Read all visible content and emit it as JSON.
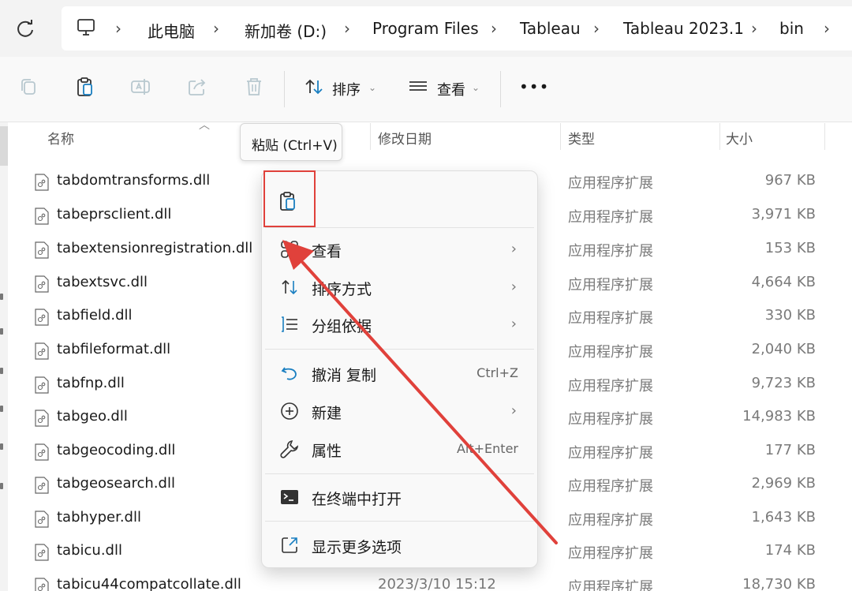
{
  "address_bar": {
    "crumbs": [
      "此电脑",
      "新加卷 (D:)",
      "Program Files",
      "Tableau",
      "Tableau 2023.1",
      "bin"
    ]
  },
  "toolbar": {
    "sort_label": "排序",
    "view_label": "查看",
    "more_label": "•••"
  },
  "columns": {
    "name": "名称",
    "date": "修改日期",
    "type": "类型",
    "size": "大小"
  },
  "files": [
    {
      "name": "tabdomtransforms.dll",
      "type": "应用程序扩展",
      "size": "967 KB"
    },
    {
      "name": "tabeprsclient.dll",
      "type": "应用程序扩展",
      "size": "3,971 KB"
    },
    {
      "name": "tabextensionregistration.dll",
      "type": "应用程序扩展",
      "size": "153 KB"
    },
    {
      "name": "tabextsvc.dll",
      "type": "应用程序扩展",
      "size": "4,664 KB"
    },
    {
      "name": "tabfield.dll",
      "type": "应用程序扩展",
      "size": "330 KB"
    },
    {
      "name": "tabfileformat.dll",
      "type": "应用程序扩展",
      "size": "2,040 KB"
    },
    {
      "name": "tabfnp.dll",
      "type": "应用程序扩展",
      "size": "9,723 KB"
    },
    {
      "name": "tabgeo.dll",
      "type": "应用程序扩展",
      "size": "14,983 KB"
    },
    {
      "name": "tabgeocoding.dll",
      "type": "应用程序扩展",
      "size": "177 KB"
    },
    {
      "name": "tabgeosearch.dll",
      "type": "应用程序扩展",
      "size": "2,969 KB"
    },
    {
      "name": "tabhyper.dll",
      "type": "应用程序扩展",
      "size": "1,643 KB"
    },
    {
      "name": "tabicu.dll",
      "type": "应用程序扩展",
      "size": "174 KB"
    },
    {
      "name": "tabicu44compatcollate.dll",
      "date": "2023/3/10 15:12",
      "type": "应用程序扩展",
      "size": "18,730 KB"
    }
  ],
  "tooltip": {
    "text": "粘贴 (Ctrl+V)"
  },
  "context_menu": {
    "view": "查看",
    "sort_by": "排序方式",
    "group_by": "分组依据",
    "undo": "撤消 复制",
    "undo_shortcut": "Ctrl+Z",
    "new": "新建",
    "properties": "属性",
    "properties_shortcut": "Alt+Enter",
    "open_terminal": "在终端中打开",
    "more_options": "显示更多选项"
  },
  "colors": {
    "highlight_box": "#e0413b",
    "arrow": "#e0413b"
  }
}
